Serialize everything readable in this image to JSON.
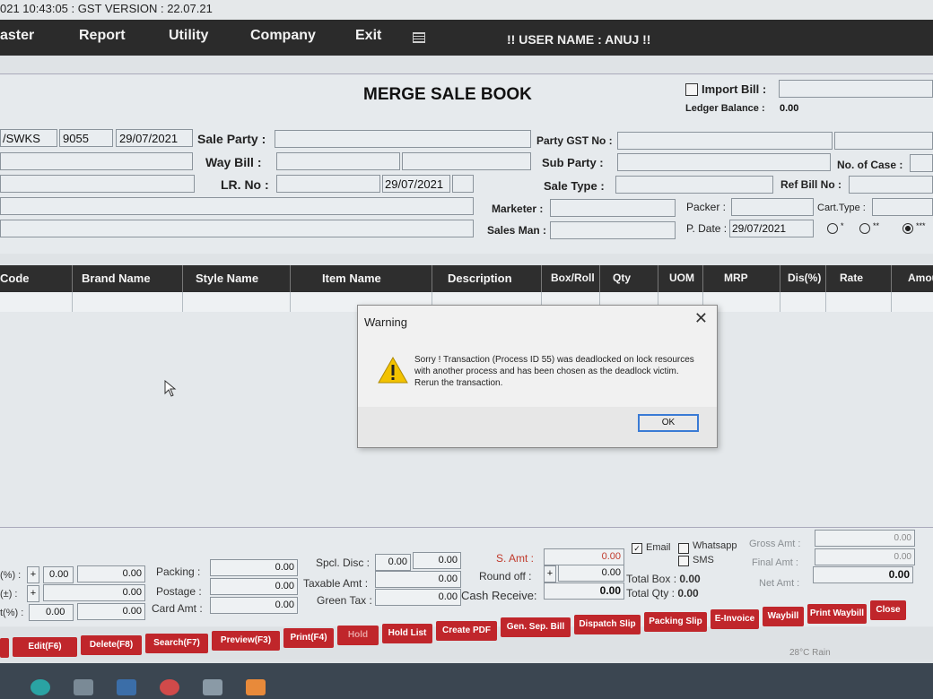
{
  "titlebar": {
    "text": "021 10:43:05 : GST VERSION : 22.07.21"
  },
  "menu": {
    "items": [
      "aster",
      "Report",
      "Utility",
      "Company",
      "Exit"
    ],
    "user": "!! USER NAME  : ANUJ !!"
  },
  "form": {
    "title": "MERGE SALE BOOK",
    "import_bill": "Import Bill :",
    "ledger_balance_label": "Ledger Balance :",
    "ledger_balance_value": "0.00",
    "series": "/SWKS",
    "bill_no": "9055",
    "bill_date": "29/07/2021",
    "sale_party_label": "Sale Party :",
    "way_bill_label": "Way Bill  :",
    "lr_no_label": "LR. No :",
    "lr_date": "29/07/2021",
    "party_gst_label": "Party GST No :",
    "sub_party_label": "Sub Party  :",
    "sale_type_label": "Sale Type :",
    "no_of_case_label": "No. of Case :",
    "ref_bill_label": "Ref Bill No :",
    "marketer_label": "Marketer :",
    "sales_man_label": "Sales Man :",
    "packer_label": "Packer :",
    "p_date_label": "P. Date :",
    "p_date_value": "29/07/2021",
    "cart_type_label": "Cart.Type :",
    "radio_opts": [
      "*",
      "**",
      "***"
    ]
  },
  "grid": {
    "columns": [
      "Code",
      "Brand Name",
      "Style Name",
      "Item Name",
      "Description",
      "Box/Roll",
      "Qty",
      "UOM",
      "MRP",
      "Dis(%)",
      "Rate",
      "Amou"
    ]
  },
  "dialog": {
    "title": "Warning",
    "message": "Sorry ! Transaction (Process ID 55) was deadlocked on lock resources with another process and has been chosen as the deadlock victim. Rerun the transaction.",
    "ok_label": "OK",
    "close_glyph": "✕"
  },
  "summary": {
    "left_labels": [
      "(%) :",
      "(±) :",
      "t(%) :"
    ],
    "plus": "+",
    "left_vals": [
      "0.00",
      "0.00",
      "0.00",
      "0.00",
      "0.00"
    ],
    "packing_label": "Packing :",
    "postage_label": "Postage :",
    "card_amt_label": "Card Amt :",
    "packing_val": "0.00",
    "postage_val": "0.00",
    "card_amt_val": "0.00",
    "spcl_disc_label": "Spcl. Disc :",
    "spcl_disc_val1": "0.00",
    "spcl_disc_val2": "0.00",
    "taxable_label": "Taxable Amt :",
    "taxable_val": "0.00",
    "green_tax_label": "Green Tax :",
    "green_tax_val": "0.00",
    "s_amt_label": "S. Amt :",
    "s_amt_val": "0.00",
    "round_off_label": "Round off :",
    "round_off_val": "0.00",
    "cash_receive_label": "Cash Receive:",
    "cash_receive_val": "0.00",
    "email_label": "Email",
    "whatsapp_label": "Whatsapp",
    "sms_label": "SMS",
    "total_box_label": "Total Box : ",
    "total_box_val": "0.00",
    "total_qty_label": "Total Qty : ",
    "total_qty_val": "0.00",
    "gross_amt_label": "Gross Amt :",
    "gross_amt_val": "0.00",
    "final_amt_label": "Final Amt :",
    "final_amt_val": "0.00",
    "net_amt_label": "Net Amt :",
    "net_amt_val": "0.00",
    "right_top_val": "0.00"
  },
  "buttons": [
    "Edit(F6)",
    "Delete(F8)",
    "Search(F7)",
    "Preview(F3)",
    "Print(F4)",
    "Hold",
    "Hold List",
    "Create PDF",
    "Gen. Sep. Bill",
    "Dispatch Slip",
    "Packing Slip",
    "E-Invoice",
    "Waybill",
    "Print Waybill",
    "Close"
  ],
  "taskbar": {
    "weather": "28°C  Rain"
  },
  "colors": {
    "menubar": "#2b2b2b",
    "button_red": "#c0262b",
    "grid_header": "#2e2e2e"
  }
}
